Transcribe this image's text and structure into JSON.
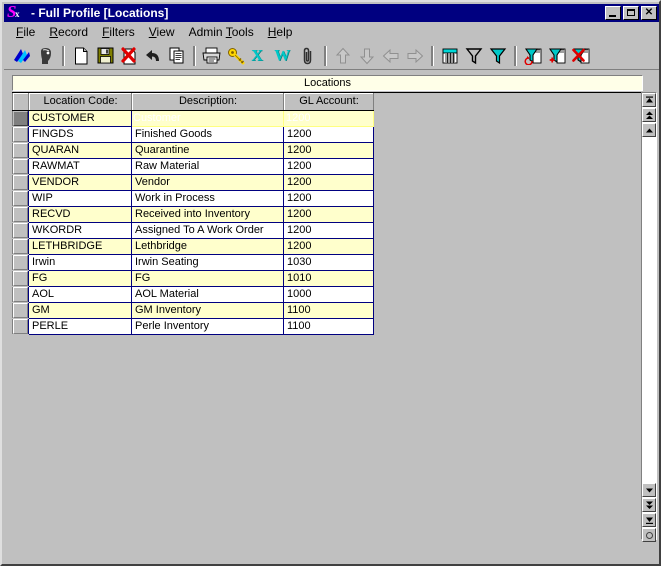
{
  "window": {
    "title": "- Full Profile [Locations]",
    "icon": "app-logo-icon",
    "controls": {
      "minimize": "minimize-button",
      "maximize": "maximize-button",
      "close": "close-button"
    }
  },
  "menu": {
    "items": [
      {
        "label": "File",
        "accel": "F"
      },
      {
        "label": "Record",
        "accel": "R"
      },
      {
        "label": "Filters",
        "accel": "F"
      },
      {
        "label": "View",
        "accel": "V"
      },
      {
        "label": "Admin Tools",
        "accel": "T"
      },
      {
        "label": "Help",
        "accel": "H"
      }
    ]
  },
  "toolbar": {
    "buttons": [
      {
        "name": "logo-icon",
        "tip": "Application Logo"
      },
      {
        "name": "user-head-icon",
        "tip": "User"
      },
      {
        "name": "separator"
      },
      {
        "name": "new-document-icon",
        "tip": "New"
      },
      {
        "name": "save-disk-icon",
        "tip": "Save"
      },
      {
        "name": "delete-record-icon",
        "tip": "Delete"
      },
      {
        "name": "undo-arrow-icon",
        "tip": "Undo"
      },
      {
        "name": "copy-icon",
        "tip": "Copy"
      },
      {
        "name": "separator"
      },
      {
        "name": "print-icon",
        "tip": "Print"
      },
      {
        "name": "key-icon",
        "tip": "Security"
      },
      {
        "name": "excel-export-icon",
        "tip": "Export to Excel"
      },
      {
        "name": "word-export-icon",
        "tip": "Export to Word"
      },
      {
        "name": "attachment-clip-icon",
        "tip": "Attachment"
      },
      {
        "name": "separator"
      },
      {
        "name": "move-up-icon",
        "tip": "Move Up"
      },
      {
        "name": "move-down-icon",
        "tip": "Move Down"
      },
      {
        "name": "move-left-icon",
        "tip": "Move Left"
      },
      {
        "name": "move-right-icon",
        "tip": "Move Right"
      },
      {
        "name": "separator"
      },
      {
        "name": "grid-filter-icon",
        "tip": "Grid"
      },
      {
        "name": "filter-outline-icon",
        "tip": "Filter"
      },
      {
        "name": "filter-solid-icon",
        "tip": "Apply Filter"
      },
      {
        "name": "separator"
      },
      {
        "name": "filter-refresh-icon",
        "tip": "Refresh Filter"
      },
      {
        "name": "filter-add-icon",
        "tip": "Add Filter"
      },
      {
        "name": "filter-remove-icon",
        "tip": "Remove Filter"
      }
    ]
  },
  "grid": {
    "caption": "Locations",
    "columns": [
      {
        "key": "code",
        "label": "Location Code:"
      },
      {
        "key": "desc",
        "label": "Description:"
      },
      {
        "key": "gl",
        "label": "GL Account:"
      }
    ],
    "rows": [
      {
        "code": "CUSTOMER",
        "desc": "Customer",
        "gl": "1200"
      },
      {
        "code": "FINGDS",
        "desc": "Finished Goods",
        "gl": "1200"
      },
      {
        "code": "QUARAN",
        "desc": "Quarantine",
        "gl": "1200"
      },
      {
        "code": "RAWMAT",
        "desc": "Raw Material",
        "gl": "1200"
      },
      {
        "code": "VENDOR",
        "desc": "Vendor",
        "gl": "1200"
      },
      {
        "code": "WIP",
        "desc": "Work in Process",
        "gl": "1200"
      },
      {
        "code": "RECVD",
        "desc": "Received into Inventory",
        "gl": "1200"
      },
      {
        "code": "WKORDR",
        "desc": "Assigned To A Work Order",
        "gl": "1200"
      },
      {
        "code": "LETHBRIDGE",
        "desc": "Lethbridge",
        "gl": "1200"
      },
      {
        "code": "Irwin",
        "desc": "Irwin Seating",
        "gl": "1030"
      },
      {
        "code": "FG",
        "desc": "FG",
        "gl": "1010"
      },
      {
        "code": "AOL",
        "desc": "AOL Material",
        "gl": "1000"
      },
      {
        "code": "GM",
        "desc": "GM Inventory",
        "gl": "1100"
      },
      {
        "code": "PERLE",
        "desc": "Perle Inventory",
        "gl": "1100"
      }
    ],
    "current_row_index": 0,
    "selected_cells": [
      "desc",
      "gl"
    ]
  },
  "navigation": {
    "buttons": [
      {
        "name": "scroll-top-button",
        "glyph": "top"
      },
      {
        "name": "scroll-page-up-button",
        "glyph": "page-up"
      },
      {
        "name": "scroll-line-up-button",
        "glyph": "line-up"
      },
      {
        "name": "scroll-line-down-button",
        "glyph": "line-down"
      },
      {
        "name": "scroll-page-down-button",
        "glyph": "page-down"
      },
      {
        "name": "scroll-bottom-button",
        "glyph": "bottom"
      },
      {
        "name": "scroll-marker-button",
        "glyph": "circle"
      }
    ]
  },
  "colors": {
    "title_bar": "#000080",
    "face": "#c0c0c0",
    "row_alt": "#ffffcc",
    "row_base": "#ffffff",
    "selection": "#000080",
    "focus_border": "#ffff80",
    "caption_bg": "#ffffe8"
  }
}
